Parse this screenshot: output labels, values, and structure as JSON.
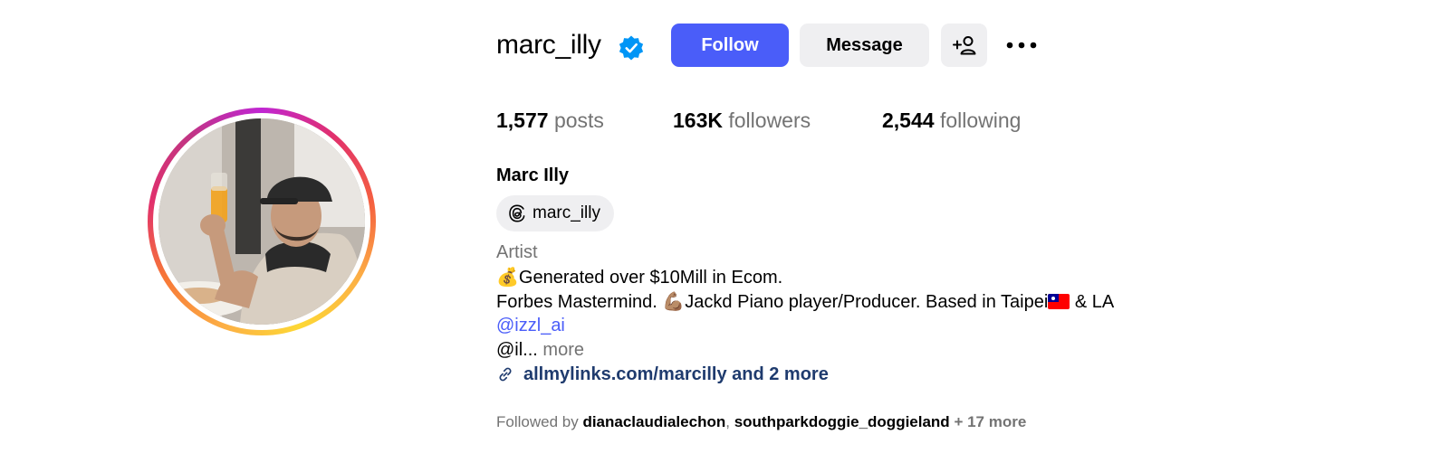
{
  "profile": {
    "username": "marc_illy",
    "full_name": "Marc Illy",
    "verified": true,
    "threads_handle": "marc_illy",
    "category": "Artist",
    "bio": {
      "line1_emoji": "💰",
      "line1_text": "Generated over $10Mill in Ecom.",
      "line2_a": "Forbes Mastermind. ",
      "line2_emoji": "💪🏽",
      "line2_b": "Jackd Piano player/Producer. Based in Taipei",
      "line2_c": " & LA",
      "line3_mention": "@izzl_ai",
      "line4_text": "@il...",
      "line4_more": "more"
    },
    "link": "allmylinks.com/marcilly and 2 more"
  },
  "actions": {
    "follow_label": "Follow",
    "message_label": "Message",
    "add_user_icon": "add-user-icon",
    "more_icon": "more-options-icon"
  },
  "stats": {
    "posts_count": "1,577",
    "posts_label": "posts",
    "followers_count": "163K",
    "followers_label": "followers",
    "following_count": "2,544",
    "following_label": "following"
  },
  "followed_by": {
    "prefix": "Followed by",
    "account1": "dianaclaudialechon",
    "separator": ",",
    "account2": "southparkdoggie_doggieland",
    "extra": "+ 17 more"
  },
  "colors": {
    "follow_button": "#4a5df9",
    "secondary_button": "#efeff1",
    "mention": "#4a5df9",
    "link": "#1f3b6e",
    "muted_text": "#737373",
    "verified_badge": "#0095f6"
  }
}
